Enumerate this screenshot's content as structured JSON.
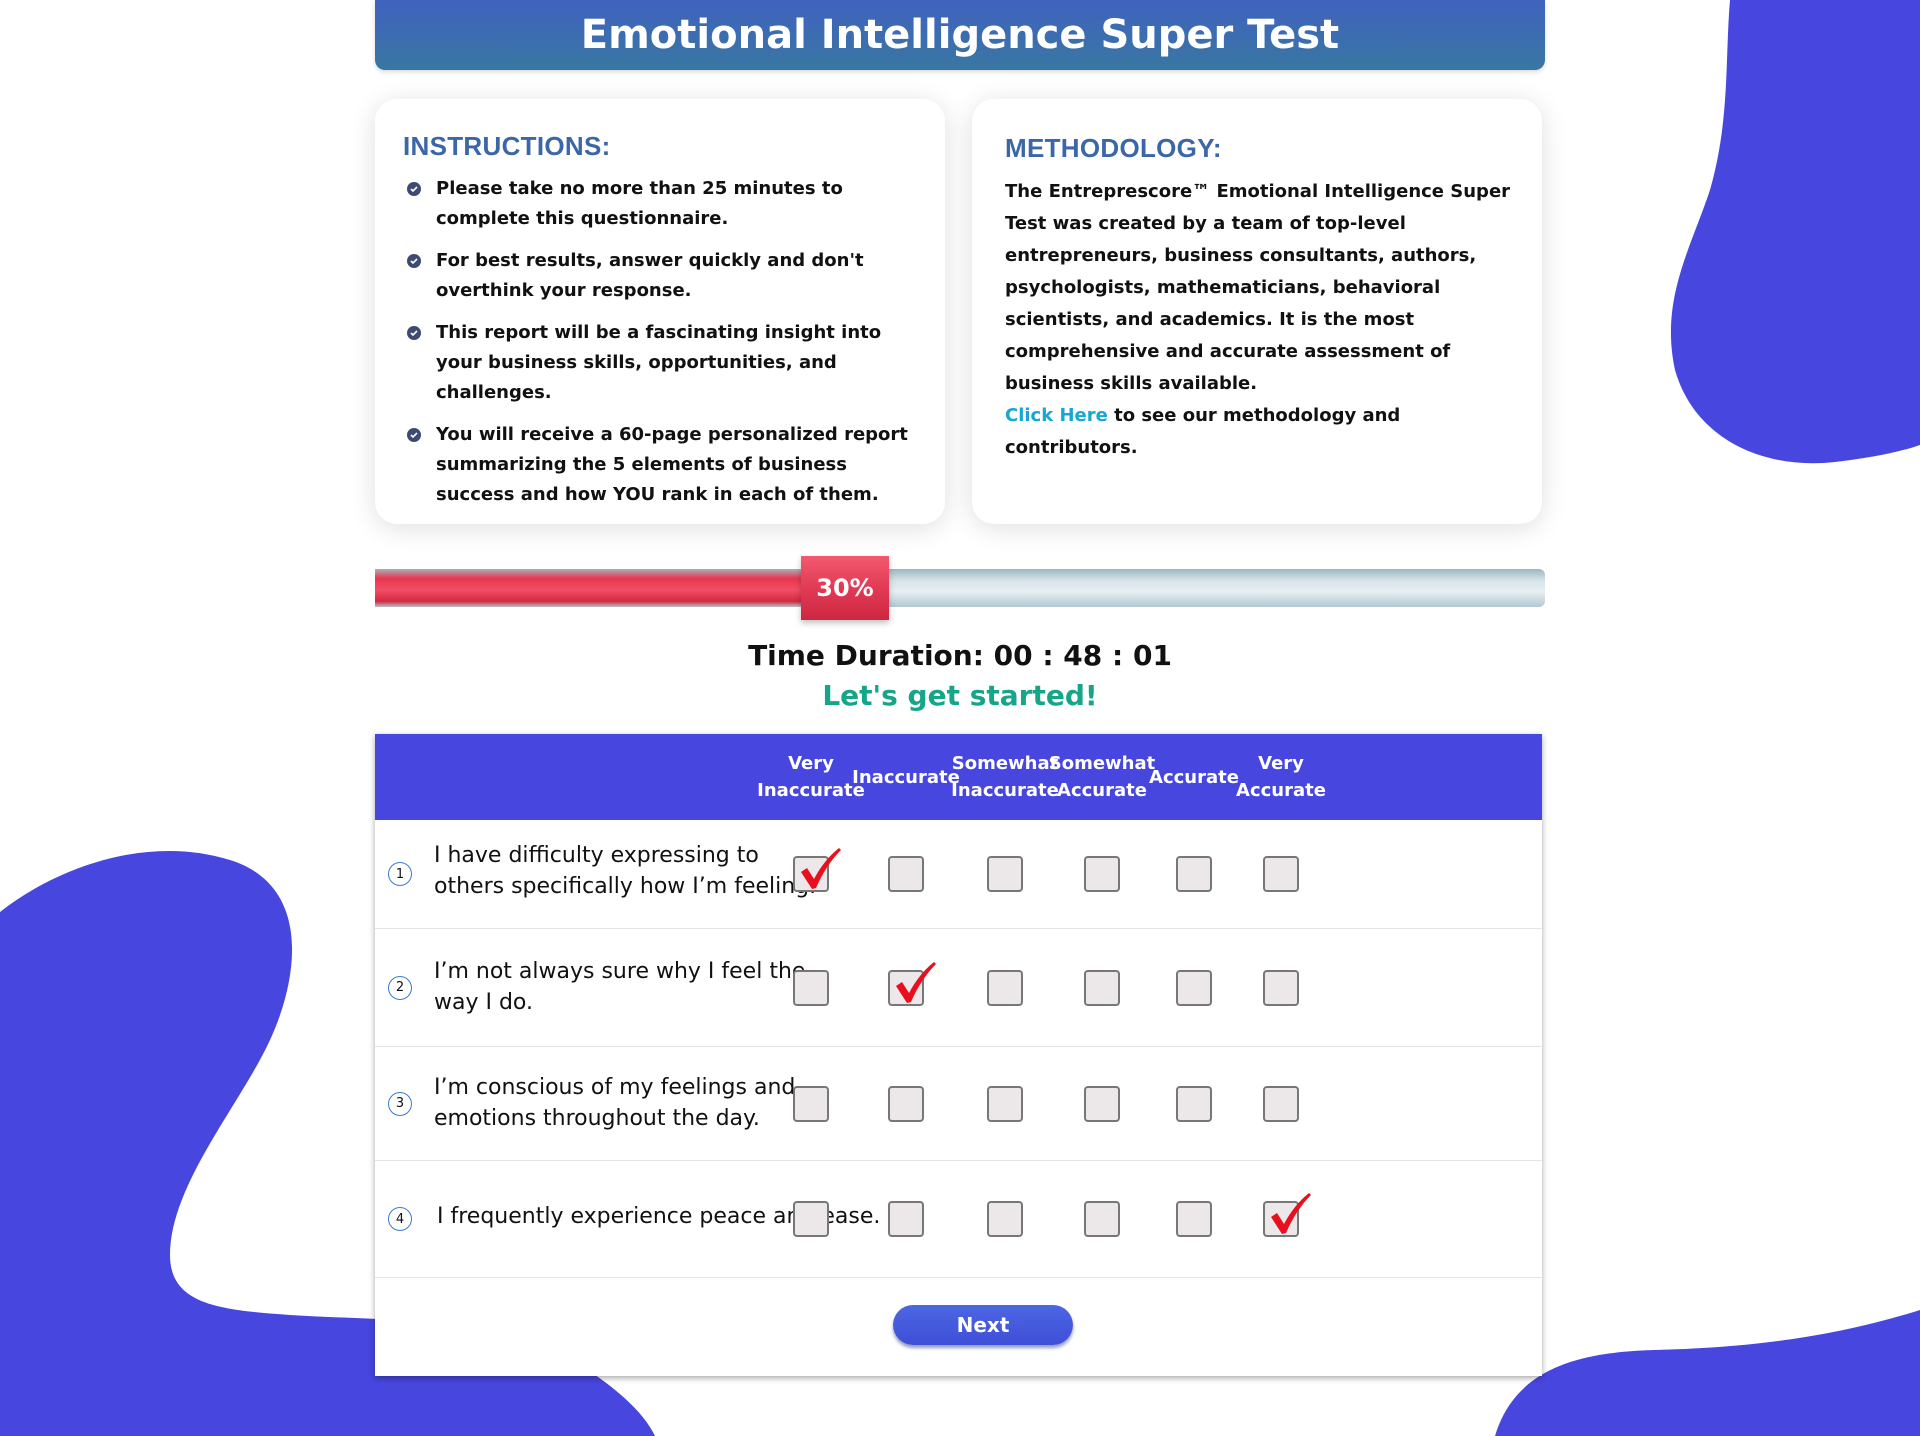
{
  "header": {
    "title": "Emotional Intelligence Super Test"
  },
  "instructions": {
    "heading": "INSTRUCTIONS:",
    "items": [
      "Please take no more than 25 minutes to complete this questionnaire.",
      "For best results, answer quickly and don't overthink your response.",
      "This report will be a fascinating insight into your business skills, opportunities, and challenges.",
      "You will receive a 60-page personalized report summarizing the 5 elements of business success and how YOU rank in each of them."
    ]
  },
  "methodology": {
    "heading": "METHODOLOGY:",
    "body": "The Entreprescore™ Emotional Intelligence Super Test was created by a team of top-level entrepreneurs, business consultants, authors, psychologists, mathematicians, behavioral scientists, and academics. It is the most comprehensive and accurate assessment of business skills available.",
    "link_text": "Click Here",
    "link_suffix": " to see our methodology and contributors."
  },
  "progress": {
    "percent": 30,
    "label": "30%"
  },
  "timer": {
    "label": "Time Duration: 00 : 48 : 01"
  },
  "greeting": "Let's get started!",
  "quiz": {
    "columns": [
      "Very\nInaccurate",
      "Inaccurate",
      "Somewhat\nInaccurate",
      "Somewhat\nAccurate",
      "Accurate",
      "Very\nAccurate"
    ],
    "questions": [
      {
        "number": "1",
        "text": "I have difficulty expressing to others specifically how I’m feeling.",
        "selected": 0
      },
      {
        "number": "2",
        "text": "I’m not always sure why I feel the way I do.",
        "selected": 1
      },
      {
        "number": "3",
        "text": "I’m conscious of my feelings and emotions throughout the day.",
        "selected": null
      },
      {
        "number": "4",
        "text": "I frequently experience peace and ease.",
        "selected": 5
      }
    ],
    "next_label": "Next"
  },
  "colors": {
    "accent_blue": "#4746df",
    "progress_red": "#e23a55",
    "link": "#16a7d6",
    "greeting_green": "#15a589",
    "heading_blue": "#3b66a8",
    "checkmark_red": "#e8101e"
  },
  "icons": {
    "bullet": "check-circle-icon",
    "selected_mark": "checkmark-icon"
  }
}
